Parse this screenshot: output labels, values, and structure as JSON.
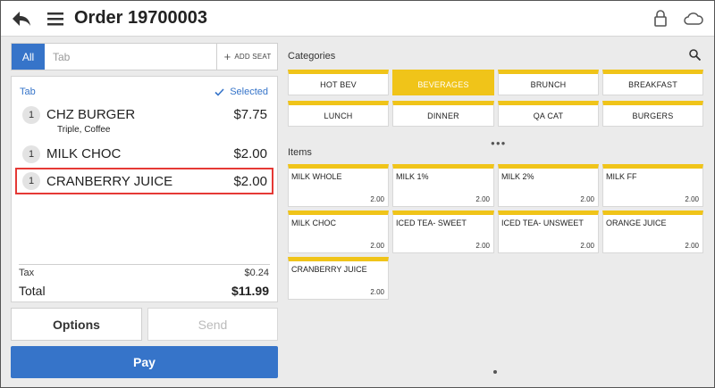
{
  "header": {
    "title": "Order 19700003"
  },
  "tabbar": {
    "all_label": "All",
    "tab_placeholder": "Tab",
    "add_seat_label": "ADD SEAT"
  },
  "order": {
    "tab_header": "Tab",
    "selected_label": "Selected",
    "lines": [
      {
        "qty": "1",
        "name": "CHZ BURGER",
        "price": "$7.75",
        "mods": "Triple, Coffee"
      },
      {
        "qty": "1",
        "name": "MILK CHOC",
        "price": "$2.00"
      },
      {
        "qty": "1",
        "name": "CRANBERRY JUICE",
        "price": "$2.00"
      }
    ],
    "tax_label": "Tax",
    "tax_value": "$0.24",
    "total_label": "Total",
    "total_value": "$11.99"
  },
  "actions": {
    "options_label": "Options",
    "send_label": "Send",
    "pay_label": "Pay"
  },
  "categories": {
    "label": "Categories",
    "items": [
      "HOT BEV",
      "BEVERAGES",
      "BRUNCH",
      "BREAKFAST",
      "LUNCH",
      "DINNER",
      "QA CAT",
      "BURGERS"
    ],
    "active": "BEVERAGES"
  },
  "items": {
    "label": "Items",
    "list": [
      {
        "name": "MILK WHOLE",
        "price": "2.00"
      },
      {
        "name": "MILK 1%",
        "price": "2.00"
      },
      {
        "name": "MILK 2%",
        "price": "2.00"
      },
      {
        "name": "MILK FF",
        "price": "2.00"
      },
      {
        "name": "MILK CHOC",
        "price": "2.00"
      },
      {
        "name": "ICED TEA- SWEET",
        "price": "2.00"
      },
      {
        "name": "ICED TEA- UNSWEET",
        "price": "2.00"
      },
      {
        "name": "ORANGE JUICE",
        "price": "2.00"
      },
      {
        "name": "CRANBERRY JUICE",
        "price": "2.00"
      }
    ]
  },
  "colors": {
    "accent_blue": "#3674c9",
    "tile_yellow": "#f0c419",
    "selected_outline": "#e53935"
  },
  "icons": {
    "back": "back-arrow-icon",
    "menu": "hamburger-menu-icon",
    "lock": "lock-icon",
    "cloud": "cloud-icon",
    "search": "search-icon",
    "check": "check-icon",
    "plus": "plus-icon"
  }
}
